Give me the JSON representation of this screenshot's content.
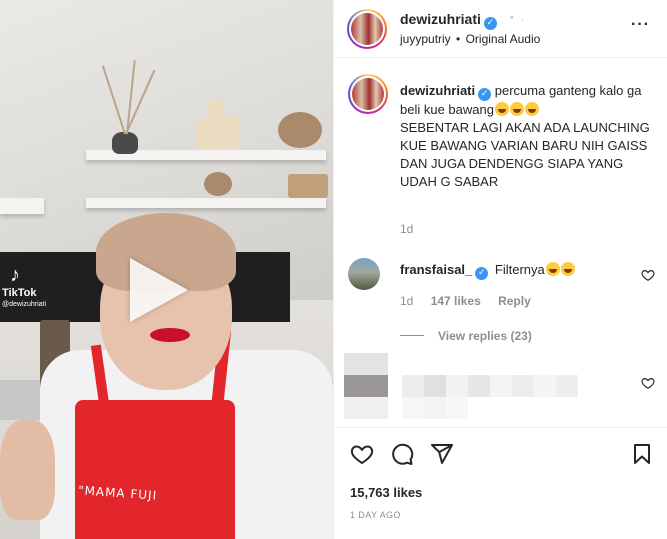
{
  "video": {
    "watermark_brand": "TikTok",
    "watermark_handle": "@dewizuhriati",
    "apron_text": "\"MAMA FUJI"
  },
  "header": {
    "username": "dewizuhriati",
    "audio_user": "juyyputriy",
    "separator": "•",
    "audio_label": "Original Audio",
    "more_icon": "more-dots-icon"
  },
  "caption": {
    "username": "dewizuhriati",
    "text_line1": "percuma ganteng kalo ga beli kue bawang",
    "text_rest": "SEBENTAR LAGI AKAN ADA LAUNCHING KUE BAWANG VARIAN BARU NIH GAISS DAN JUGA DENDENGG SIAPA YANG UDAH G SABAR",
    "time": "1d"
  },
  "comments": [
    {
      "username": "fransfaisal_",
      "text": "Filternya",
      "time": "1d",
      "likes": "147 likes",
      "reply_label": "Reply",
      "view_replies": "View replies (23)"
    }
  ],
  "post": {
    "likes": "15,763 likes",
    "date": "1 DAY AGO"
  },
  "icons": [
    "heart-icon",
    "comment-icon",
    "share-icon",
    "bookmark-icon"
  ],
  "colors": {
    "verified": "#3897f0",
    "apron": "#e3262b",
    "secondary_text": "#8e8e8e"
  }
}
